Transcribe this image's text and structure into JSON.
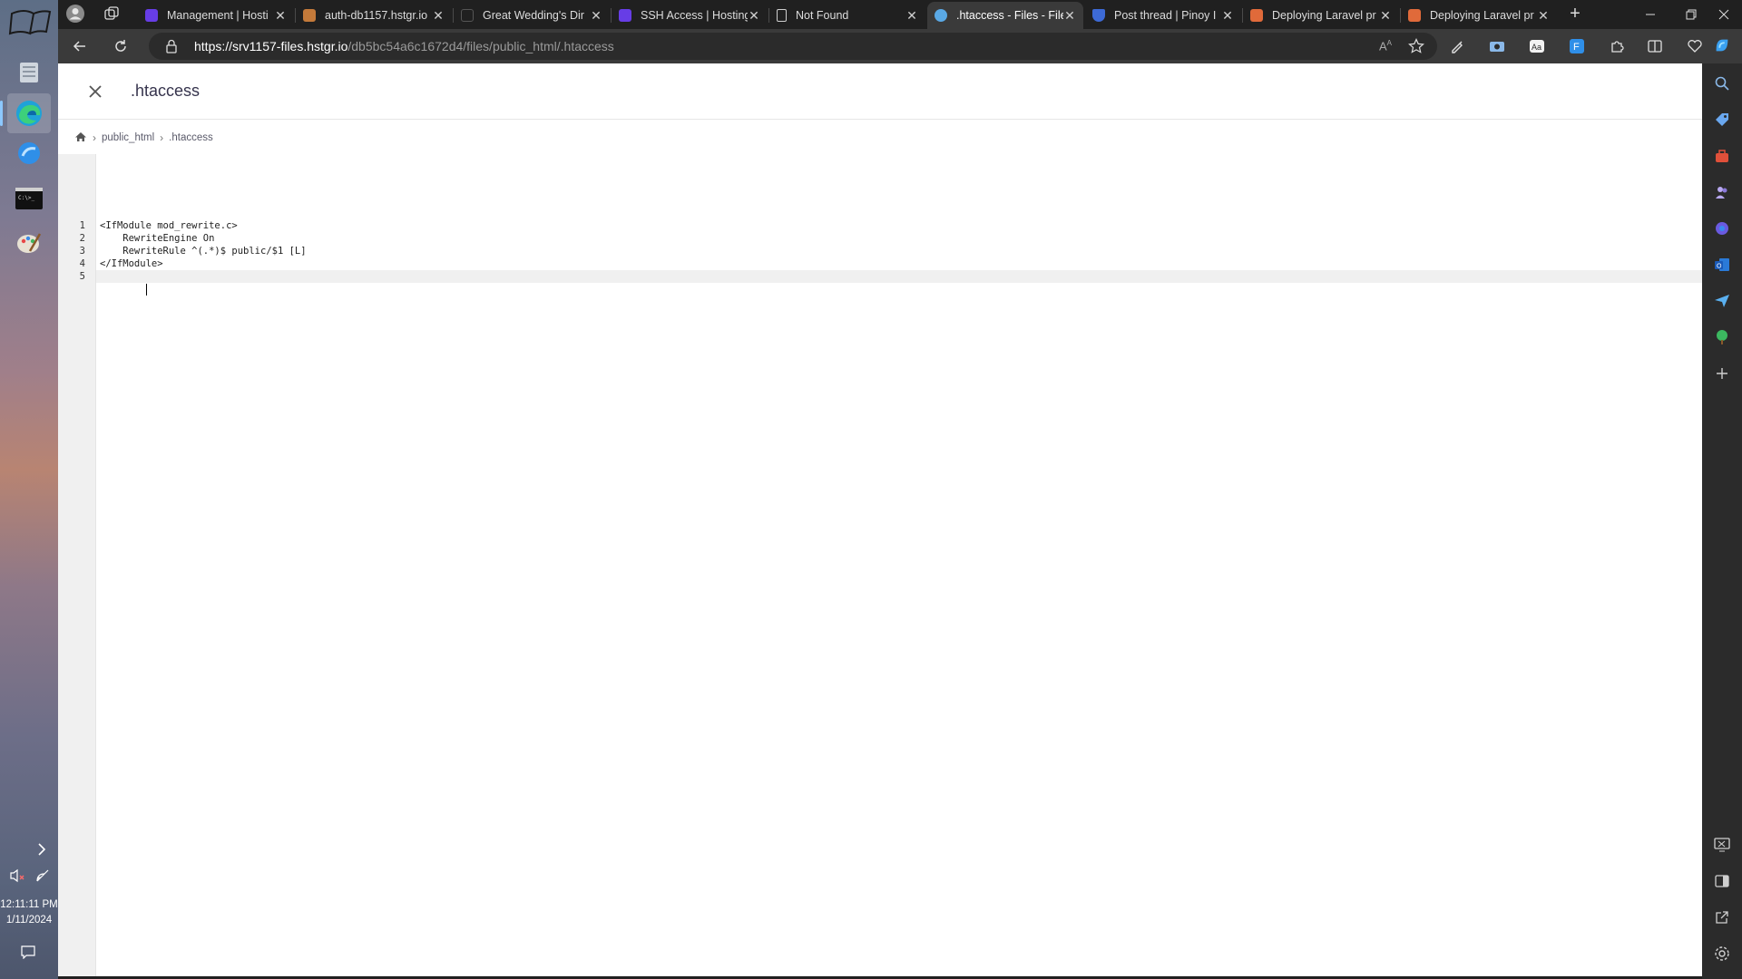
{
  "taskbar": {
    "apps": [
      {
        "name": "Files"
      },
      {
        "name": "Microsoft Edge"
      },
      {
        "name": "Browser"
      },
      {
        "name": "Terminal"
      },
      {
        "name": "Paint"
      }
    ],
    "time": "12:11:11 PM",
    "date": "1/11/2024"
  },
  "tabs": [
    {
      "title": "Management | Hosti",
      "active": false
    },
    {
      "title": "auth-db1157.hstgr.io",
      "active": false
    },
    {
      "title": "Great Wedding's Dir",
      "active": false
    },
    {
      "title": "SSH Access | Hosting",
      "active": false
    },
    {
      "title": "Not Found",
      "active": false
    },
    {
      "title": ".htaccess - Files - File",
      "active": true
    },
    {
      "title": "Post thread | Pinoy I",
      "active": false
    },
    {
      "title": "Deploying Laravel pr",
      "active": false
    },
    {
      "title": "Deploying Laravel pr",
      "active": false
    }
  ],
  "address": {
    "host": "https://srv1157-files.hstgr.io",
    "path": "/db5bc54a6c1672d4/files/public_html/.htaccess"
  },
  "editor": {
    "title": ".htaccess",
    "breadcrumb": [
      "public_html",
      ".htaccess"
    ],
    "lines": [
      {
        "num": "1",
        "text": "<IfModule mod_rewrite.c>"
      },
      {
        "num": "2",
        "text": "    RewriteEngine On"
      },
      {
        "num": "3",
        "text": "    RewriteRule ^(.*)$ public/$1 [L]"
      },
      {
        "num": "4",
        "text": "</IfModule>"
      },
      {
        "num": "5",
        "text": ""
      }
    ]
  },
  "colors": {
    "brand_accent": "#673de6",
    "page_bg": "#ffffff",
    "toolbar_bg": "#3a3a3a"
  }
}
